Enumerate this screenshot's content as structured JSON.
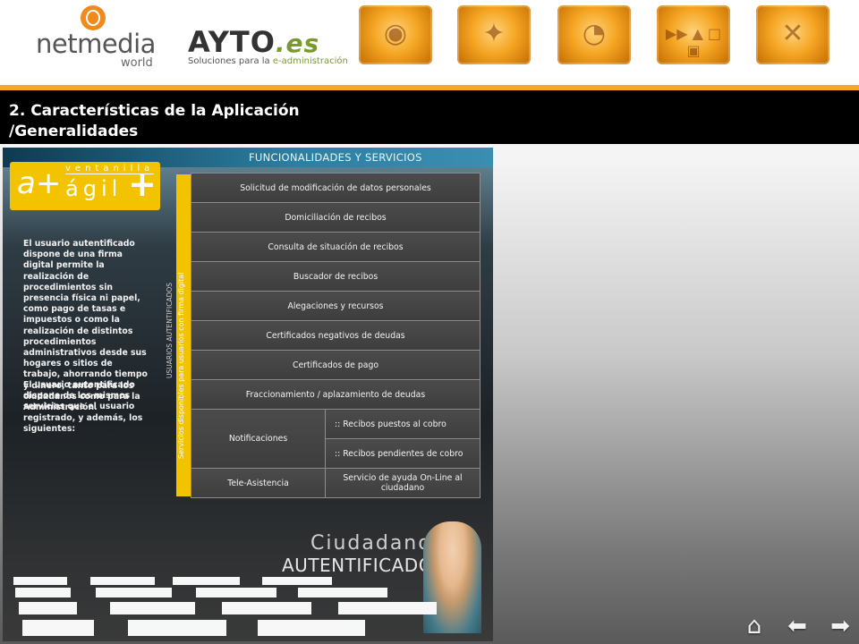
{
  "header": {
    "netmedia": {
      "name": "netmedia",
      "sub": "world"
    },
    "ayto": {
      "brand": "AYTO",
      "suffix": ".es",
      "tagline_a": "Soluciones para la ",
      "tagline_b": "e-administración"
    },
    "thumbnails": [
      "eye-thumb",
      "athlete-thumb",
      "phone-thumb",
      "media-controls-thumb",
      "network-thumb"
    ]
  },
  "slide": {
    "title_line1": "2. Características de la Aplicación",
    "title_line2": "/Generalidades"
  },
  "panel": {
    "heading": "FUNCIONALIDADES Y SERVICIOS",
    "badge": {
      "prefix": "a+",
      "top": "ventanilla",
      "main": "ágil",
      "plus": "+"
    },
    "description1": "El usuario autentificado dispone de una firma digital permite la realización de procedimientos sin presencia física ni papel, como pago de tasas e impuestos o como la realización de distintos procedimientos administrativos desde sus hogares o sitios de trabajo, ahorrando tiempo y dinero, tanto para los ciudadanos como para la Administración.",
    "description2": "El usuario autentificado dispone de los mismos servicios que el usuario registrado, y además, los siguientes:",
    "vertical_yellow": "Servicios disponibles para usuarios con firma digital",
    "vertical_side": "USUARIOS AUTENTIFICADOS",
    "services": [
      "Solicitud de modificación de datos personales",
      "Domiciliación de recibos",
      "Consulta de situación de recibos",
      "Buscador de recibos",
      "Alegaciones y recursos",
      "Certificados negativos de deudas",
      "Certificados de pago",
      "Fraccionamiento / aplazamiento de deudas"
    ],
    "notificaciones": {
      "label": "Notificaciones",
      "items": [
        ":: Recibos puestos al cobro",
        ":: Recibos pendientes de cobro"
      ]
    },
    "teleasistencia": {
      "label": "Tele-Asistencia",
      "value": "Servicio de ayuda On-Line al ciudadano"
    },
    "ciudadanos": {
      "line1": "Ciudadanos",
      "line2": "AUTENTIFICADOS"
    }
  },
  "nav": {
    "home": "⌂",
    "back": "⬅",
    "forward": "➡"
  },
  "colors": {
    "accent": "#f5a623",
    "yellow": "#f3c300",
    "titlebar": "#000000"
  }
}
